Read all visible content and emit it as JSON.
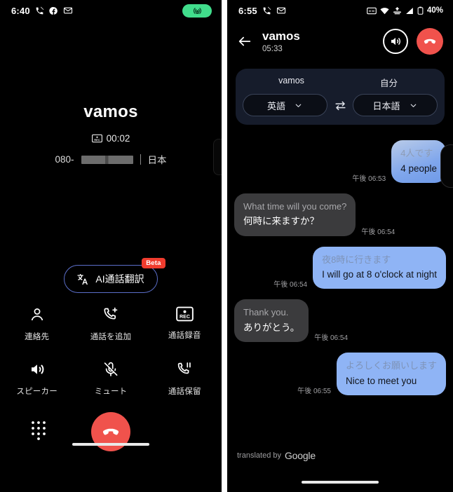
{
  "left_screen": {
    "status_bar": {
      "time": "6:40",
      "left_icons": [
        "phone-call-icon",
        "facebook-icon",
        "mail-icon"
      ],
      "recording_pill_icon": "broadcast-icon"
    },
    "call": {
      "contact_name": "vamos",
      "recording_icon": "rec-icon",
      "duration": "00:02",
      "number_prefix": "080-",
      "number_redacted": true,
      "country": "日本"
    },
    "ai_button": {
      "icon": "translate-icon",
      "label": "AI通話翻訳",
      "badge": "Beta"
    },
    "controls": [
      {
        "icon": "contact-icon",
        "label": "連絡先"
      },
      {
        "icon": "add-call-icon",
        "label": "通話を追加"
      },
      {
        "icon": "rec-icon",
        "label": "通話録音"
      },
      {
        "icon": "speaker-icon",
        "label": "スピーカー"
      },
      {
        "icon": "mute-icon",
        "label": "ミュート"
      },
      {
        "icon": "hold-call-icon",
        "label": "通話保留"
      }
    ],
    "bottom": {
      "dialpad_icon": "dialpad-icon",
      "end_call_icon": "end-call-icon"
    }
  },
  "right_screen": {
    "status_bar": {
      "time": "6:55",
      "left_icons": [
        "phone-call-icon",
        "mail-icon"
      ],
      "right_icons": [
        "captions-icon",
        "wifi-icon",
        "vpn-icon",
        "signal-icon",
        "battery-icon"
      ],
      "battery": "40%"
    },
    "header": {
      "back_icon": "back-arrow-icon",
      "title": "vamos",
      "duration": "05:33",
      "speaker_icon": "speaker-icon",
      "end_call_icon": "end-call-icon"
    },
    "languages": {
      "remote_party": "vamos",
      "remote_language": "英語",
      "self_party": "自分",
      "self_language": "日本語",
      "swap_icon": "swap-icon",
      "chevron_icon": "chevron-down-icon"
    },
    "messages": [
      {
        "side": "right",
        "style": "gradient",
        "source": "4人です",
        "translation": "4 people",
        "time": "午後 06:53"
      },
      {
        "side": "left",
        "style": "them",
        "source": "What time will you come?",
        "translation": "何時に来ますか？",
        "time": "午後 06:54"
      },
      {
        "side": "right",
        "style": "me",
        "source": "夜8時に行きます",
        "translation": "I will go at 8 o'clock at night",
        "time": "午後 06:54"
      },
      {
        "side": "left",
        "style": "them",
        "source": "Thank you.",
        "translation": "ありがとう。",
        "time": "午後 06:54"
      },
      {
        "side": "right",
        "style": "me",
        "source": "よろしくお願いします",
        "translation": "Nice to meet you",
        "time": "午後 06:55"
      }
    ],
    "footer": {
      "prefix": "translated by",
      "brand": "Google"
    }
  },
  "colors": {
    "accent_red": "#f0524c",
    "accent_green": "#41dd8c",
    "bubble_me": "#8fb4f5",
    "bubble_them": "#3b3b3d",
    "panel_blue": "#161c2b",
    "beta_badge": "#f03c2e"
  }
}
